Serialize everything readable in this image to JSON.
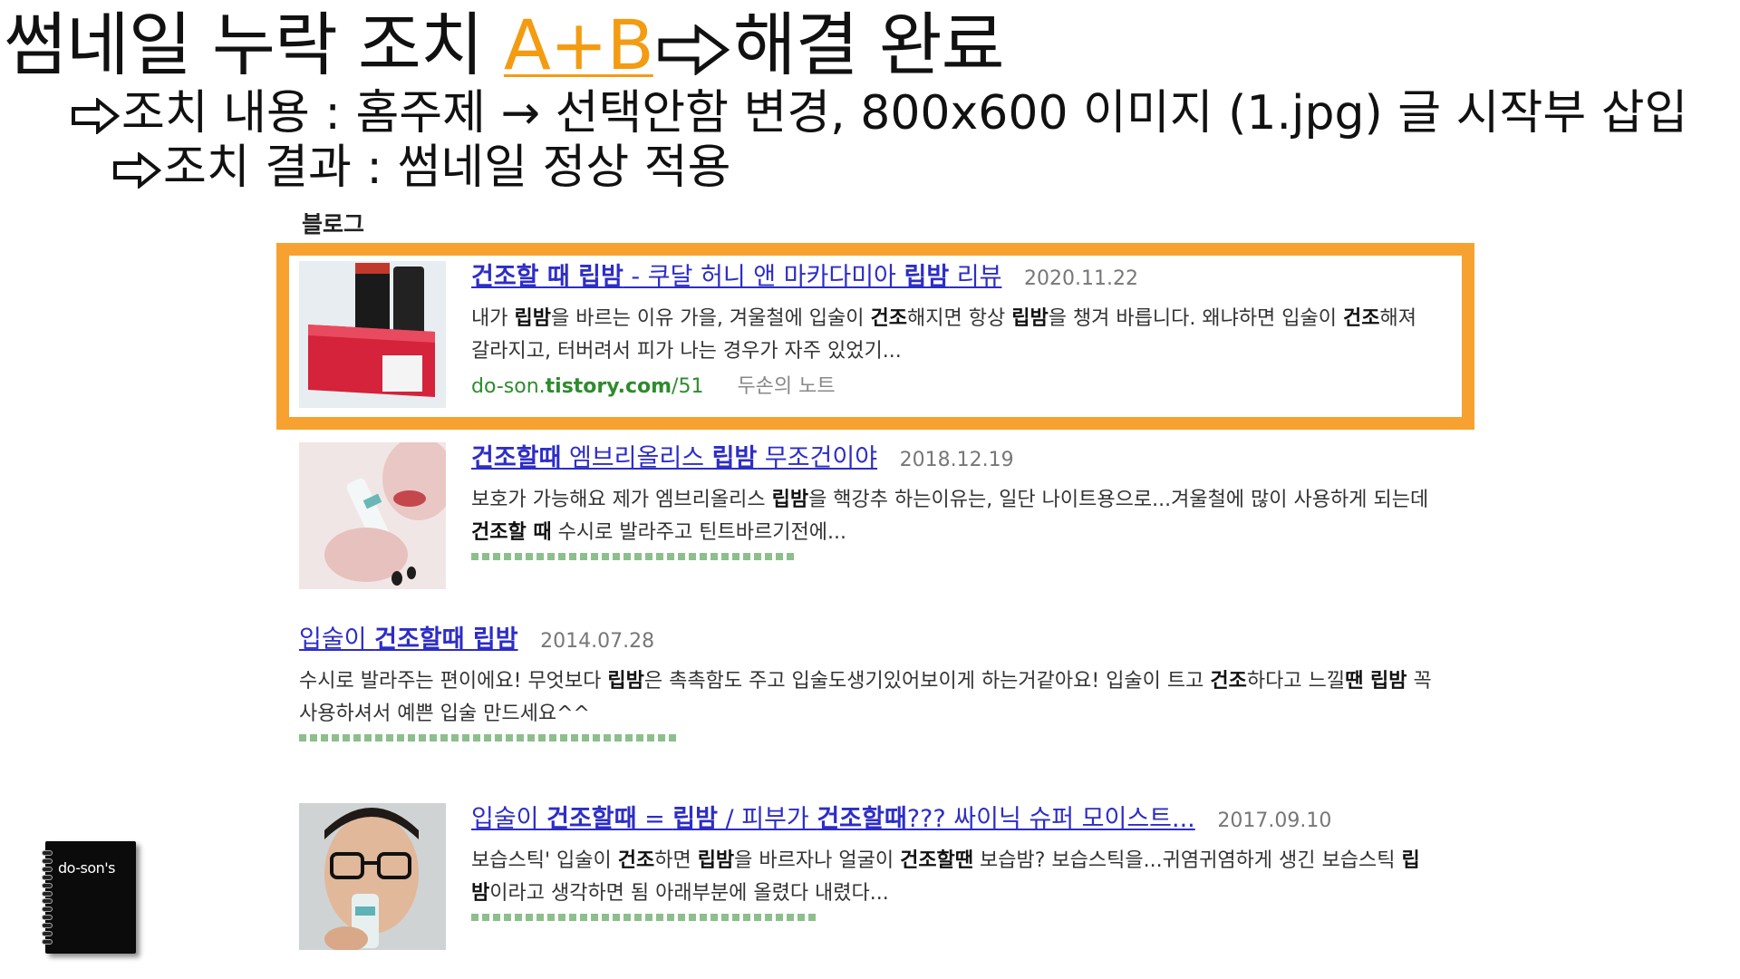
{
  "heading": {
    "part1": "썸네일 누락 조치 ",
    "accent": "A+B",
    "part2": "해결 완료",
    "accent_color": "#f39c12"
  },
  "detail1": {
    "text": "조치 내용 : 홈주제 → 선택안함 변경, 800x600 이미지 (1.jpg) 글 시작부 삽입"
  },
  "detail2": {
    "text": "조치 결과 : 썸네일 정상 적용"
  },
  "section_label": "블로그",
  "highlight_color": "#f7a230",
  "results": [
    {
      "title_parts": [
        {
          "t": "건조할 때 립밤",
          "b": true
        },
        {
          "t": " - 쿠달 허니 앤 마카다미아 ",
          "b": false
        },
        {
          "t": "립밤",
          "b": true
        },
        {
          "t": " 리뷰",
          "b": false
        }
      ],
      "date": "2020.11.22",
      "desc_parts": [
        {
          "t": "내가 ",
          "b": false
        },
        {
          "t": "립밤",
          "b": true
        },
        {
          "t": "을 바르는 이유 가을, 겨울철에 입술이 ",
          "b": false
        },
        {
          "t": "건조",
          "b": true
        },
        {
          "t": "해지면 항상 ",
          "b": false
        },
        {
          "t": "립밤",
          "b": true
        },
        {
          "t": "을 챙겨 바릅니다. 왜냐하면 입술이 ",
          "b": false
        },
        {
          "t": "건조",
          "b": true
        },
        {
          "t": "해져 갈라지고, 터버려서 피가 나는 경우가 자주 있었기...",
          "b": false
        }
      ],
      "url_prefix": "do-son.",
      "url_bold": "tistory.com",
      "url_suffix": "/51",
      "blog_name": "두손의 노트"
    },
    {
      "title_parts": [
        {
          "t": "건조할때",
          "b": true
        },
        {
          "t": " 엠브리올리스 ",
          "b": false
        },
        {
          "t": "립밤",
          "b": true
        },
        {
          "t": " 무조건이야",
          "b": false
        }
      ],
      "date": "2018.12.19",
      "desc_parts": [
        {
          "t": "보호가 가능해요  제가 엠브리올리스 ",
          "b": false
        },
        {
          "t": "립밤",
          "b": true
        },
        {
          "t": "을 핵강추 하는이유는, 일단 나이트용으로...겨울철에 많이 사용하게 되는데 ",
          "b": false
        },
        {
          "t": "건조할 때",
          "b": true
        },
        {
          "t": " 수시로 발라주고 틴트바르기전에...",
          "b": false
        }
      ]
    },
    {
      "title_parts": [
        {
          "t": "입술이 ",
          "b": false
        },
        {
          "t": "건조할때 립밤",
          "b": true
        }
      ],
      "date": "2014.07.28",
      "desc_parts": [
        {
          "t": "수시로 발라주는 편이에요! 무엇보다 ",
          "b": false
        },
        {
          "t": "립밤",
          "b": true
        },
        {
          "t": "은 촉촉함도 주고 입술도생기있어보이게 하는거같아요! 입술이 트고 ",
          "b": false
        },
        {
          "t": "건조",
          "b": true
        },
        {
          "t": "하다고 느낄",
          "b": false
        },
        {
          "t": "땐 립밤",
          "b": true
        },
        {
          "t": " 꼭 사용하셔서 예쁜 입술 만드세요^^",
          "b": false
        }
      ]
    },
    {
      "title_parts": [
        {
          "t": "입술이 ",
          "b": false
        },
        {
          "t": "건조할때",
          "b": true
        },
        {
          "t": " = ",
          "b": false
        },
        {
          "t": "립밤",
          "b": true
        },
        {
          "t": " / 피부가 ",
          "b": false
        },
        {
          "t": "건조할때",
          "b": true
        },
        {
          "t": "??? 싸이닉 슈퍼 모이스트...",
          "b": false
        }
      ],
      "date": "2017.09.10",
      "desc_parts": [
        {
          "t": "보습스틱' 입술이 ",
          "b": false
        },
        {
          "t": "건조",
          "b": true
        },
        {
          "t": "하면 ",
          "b": false
        },
        {
          "t": "립밤",
          "b": true
        },
        {
          "t": "을 바르자나 얼굴이 ",
          "b": false
        },
        {
          "t": "건조할땐",
          "b": true
        },
        {
          "t": " 보습밤? 보습스틱을...귀염귀염하게 생긴 보습스틱 ",
          "b": false
        },
        {
          "t": "립밤",
          "b": true
        },
        {
          "t": "이라고 생각하면 됨 아래부분에 올렸다 내렸다...",
          "b": false
        }
      ]
    }
  ],
  "logo_text": "do-son's"
}
